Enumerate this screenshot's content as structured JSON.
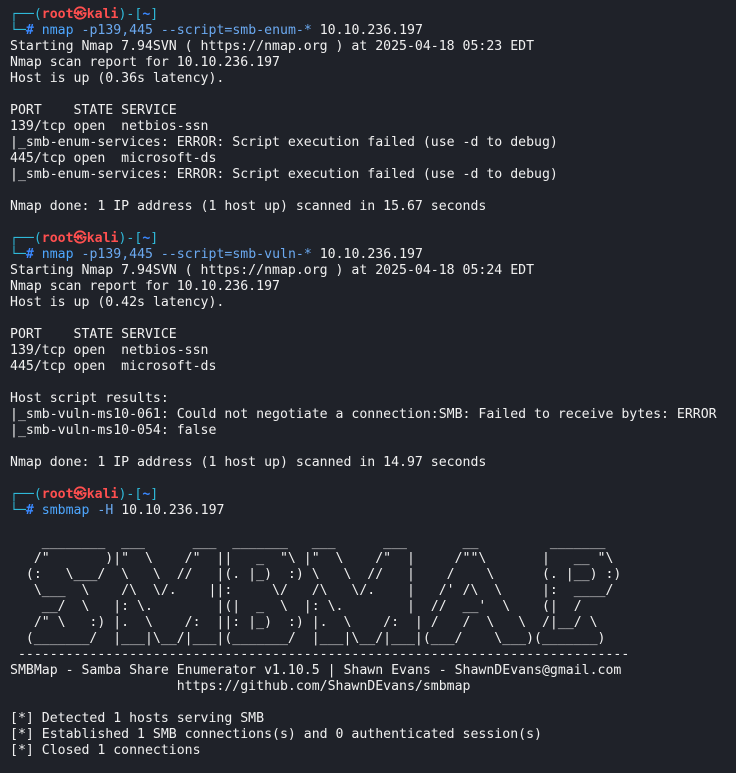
{
  "prompt": {
    "frame_top": "┌──(",
    "user": "root",
    "at": "㉿",
    "host": "kali",
    "mid": ")-[",
    "dir": "~",
    "end": "]",
    "frame_bottom": "└─",
    "hash": "#"
  },
  "blocks": [
    {
      "command": {
        "name": "nmap",
        "args": "-p139,445 --script=smb-enum-*",
        "target": "10.10.236.197"
      },
      "output": [
        "Starting Nmap 7.94SVN ( https://nmap.org ) at 2025-04-18 05:23 EDT",
        "Nmap scan report for 10.10.236.197",
        "Host is up (0.36s latency).",
        "",
        "PORT    STATE SERVICE",
        "139/tcp open  netbios-ssn",
        "|_smb-enum-services: ERROR: Script execution failed (use -d to debug)",
        "445/tcp open  microsoft-ds",
        "|_smb-enum-services: ERROR: Script execution failed (use -d to debug)",
        "",
        "Nmap done: 1 IP address (1 host up) scanned in 15.67 seconds",
        ""
      ]
    },
    {
      "command": {
        "name": "nmap",
        "args": "-p139,445 --script=smb-vuln-*",
        "target": "10.10.236.197"
      },
      "output": [
        "Starting Nmap 7.94SVN ( https://nmap.org ) at 2025-04-18 05:24 EDT",
        "Nmap scan report for 10.10.236.197",
        "Host is up (0.42s latency).",
        "",
        "PORT    STATE SERVICE",
        "139/tcp open  netbios-ssn",
        "445/tcp open  microsoft-ds",
        "",
        "Host script results:",
        "|_smb-vuln-ms10-061: Could not negotiate a connection:SMB: Failed to receive bytes: ERROR",
        "|_smb-vuln-ms10-054: false",
        "",
        "Nmap done: 1 IP address (1 host up) scanned in 14.97 seconds",
        ""
      ]
    },
    {
      "command": {
        "name": "smbmap",
        "args": "-H",
        "target": "10.10.236.197"
      },
      "output": []
    }
  ],
  "banner": [
    "",
    "    ________  ___      ___  _______   ___      ___       __         _______",
    "   /\"       )|\"  \\    /\"  ||   _  \"\\ |\"  \\    /\"  |     /\"\"\\       |   __ \"\\",
    "  (:   \\___/  \\   \\  //   |(. |_)  :) \\   \\  //   |    /    \\      (. |__) :)",
    "   \\___  \\    /\\  \\/.    ||:     \\/   /\\   \\/.    |   /' /\\  \\     |:  ____/",
    "    __/  \\   |: \\.        |(|  _  \\  |: \\.        |  //  __'  \\    (|  /",
    "   /\" \\   :) |.  \\    /:  ||: |_)  :) |.  \\    /:  | /   /  \\   \\  /|__/ \\",
    "  (_______/  |___|\\__/|___|(_______/  |___|\\__/|___|(___/    \\___)(_______)",
    " -----------------------------------------------------------------------------"
  ],
  "footer": [
    "SMBMap - Samba Share Enumerator v1.10.5 | Shawn Evans - ShawnDEvans@gmail.com",
    "                     https://github.com/ShawnDEvans/smbmap",
    "",
    "[*] Detected 1 hosts serving SMB",
    "[*] Established 1 SMB connections(s) and 0 authenticated session(s)",
    "[*] Closed 1 connections"
  ]
}
